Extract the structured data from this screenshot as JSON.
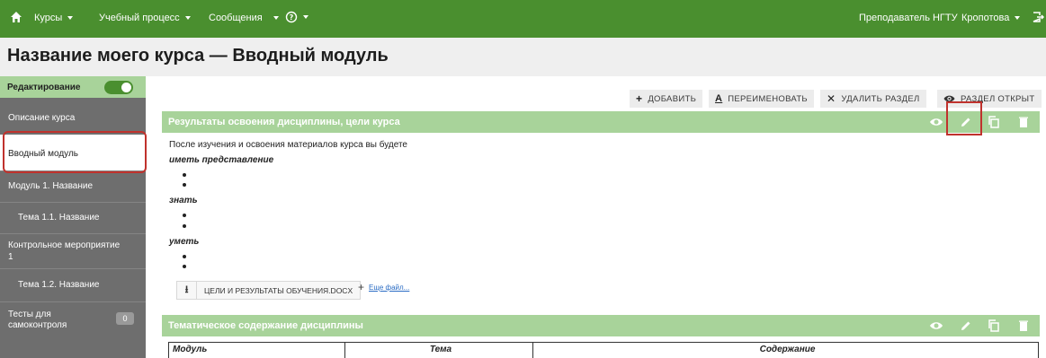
{
  "nav": {
    "courses": "Курсы",
    "learning": "Учебный процесс",
    "messages": "Сообщения",
    "user_role": "Преподаватель НГТУ",
    "user_name": "Кропотова"
  },
  "page": {
    "title": "Название моего курса — Вводный модуль"
  },
  "sidebar": {
    "edit_label": "Редактирование",
    "edit_on": true,
    "items": [
      {
        "label": "Описание курса"
      },
      {
        "label": "Вводный модуль"
      },
      {
        "label": "Модуль 1. Название"
      },
      {
        "label": "Тема 1.1. Название"
      },
      {
        "label": "Контрольное мероприятие",
        "label2": "1"
      },
      {
        "label": "Тема 1.2. Название"
      },
      {
        "label": "Тесты для",
        "label2": "самоконтроля",
        "badge": "0"
      }
    ]
  },
  "toolbar": {
    "add": "ДОБАВИТЬ",
    "rename": "ПЕРЕИМЕНОВАТЬ",
    "delete": "УДАЛИТЬ РАЗДЕЛ",
    "visibility": "РАЗДЕЛ ОТКРЫТ"
  },
  "section1": {
    "title": "Результаты освоения дисциплины, цели курса",
    "intro": "После изучения и освоения материалов курса вы будете",
    "h1": "иметь представление",
    "h2": "знать",
    "h3": "уметь",
    "file_name": "ЦЕЛИ И РЕЗУЛЬТАТЫ ОБУЧЕНИЯ.DOCX",
    "more_files": "Еще файл..."
  },
  "section2": {
    "title": "Тематическое содержание дисциплины",
    "columns": [
      "Модуль",
      "Тема",
      "Содержание"
    ]
  },
  "colors": {
    "nav": "#4a8f2f",
    "section": "#a8d39a",
    "highlight": "#c0322d"
  }
}
